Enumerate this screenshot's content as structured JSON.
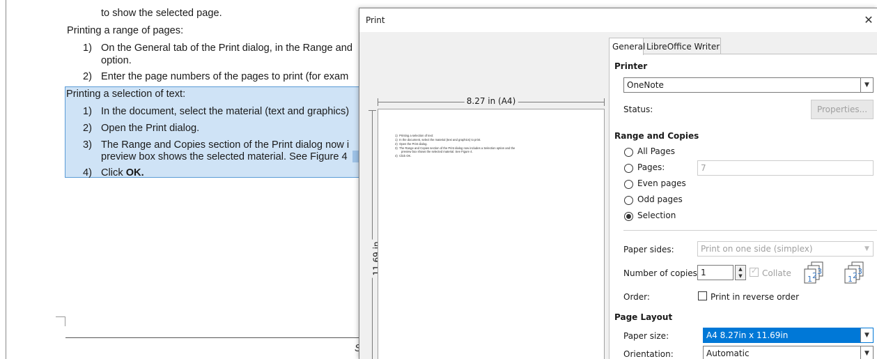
{
  "document": {
    "lines": [
      {
        "num": "",
        "text": "to show the selected page."
      },
      {
        "num": "",
        "text": "Printing a range of pages:"
      },
      {
        "num": "1)",
        "text": "On the General tab of the Print dialog, in the Range and"
      },
      {
        "num": "",
        "text": "option."
      },
      {
        "num": "2)",
        "text": "Enter the page numbers of the pages to print (for exam"
      },
      {
        "num": "",
        "text": "Printing a selection of text:"
      },
      {
        "num": "1)",
        "text": "In the document, select the material (text and graphics)"
      },
      {
        "num": "2)",
        "text": "Open the Print dialog."
      },
      {
        "num": "3)",
        "text": "The Range and Copies section of the Print dialog now i"
      },
      {
        "num": "",
        "text": "preview box shows the selected material. See Figure 4"
      },
      {
        "num": "4)",
        "text": "Click "
      }
    ],
    "click_ok_bold": "OK.",
    "footer_fragment": "S"
  },
  "dialog": {
    "title": "Print",
    "close_glyph": "✕",
    "preview": {
      "width_label": "8.27 in (A4)",
      "height_label": "11.69 in",
      "mini_lines": [
        {
          "num": "1)",
          "text": "Printing a selection of text:"
        },
        {
          "num": "1)",
          "text": "In the document, select the material (text and graphics) to print."
        },
        {
          "num": "2)",
          "text": "Open the Print dialog."
        },
        {
          "num": "3)",
          "text": "The Range and Copies section of the Print dialog now includes a Selection option and the"
        },
        {
          "num": "",
          "text": "preview box shows the selected material. See Figure 4."
        },
        {
          "num": "4)",
          "text": "Click OK."
        }
      ]
    },
    "tabs": [
      {
        "label": "General",
        "active": true
      },
      {
        "label": "LibreOffice Writer",
        "active": false
      }
    ],
    "printer": {
      "section_title": "Printer",
      "selected": "OneNote",
      "status_label": "Status:",
      "properties_button": "Properties..."
    },
    "range": {
      "section_title": "Range and Copies",
      "options": [
        {
          "label": "All Pages",
          "checked": false
        },
        {
          "label": "Pages:",
          "checked": false
        },
        {
          "label": "Even pages",
          "checked": false
        },
        {
          "label": "Odd pages",
          "checked": false
        },
        {
          "label": "Selection",
          "checked": true
        }
      ],
      "pages_value": "7",
      "paper_sides_label": "Paper sides:",
      "paper_sides_value": "Print on one side (simplex)",
      "copies_label": "Number of copies:",
      "copies_value": "1",
      "collate_label": "Collate",
      "order_label": "Order:",
      "reverse_label": "Print in reverse order"
    },
    "layout": {
      "section_title": "Page Layout",
      "paper_size_label": "Paper size:",
      "paper_size_value": "A4 8.27in x 11.69in",
      "orientation_label": "Orientation:",
      "orientation_value": "Automatic"
    },
    "colors": {
      "selection_fill": "#cfe3f6",
      "accent": "#0078d7"
    }
  }
}
